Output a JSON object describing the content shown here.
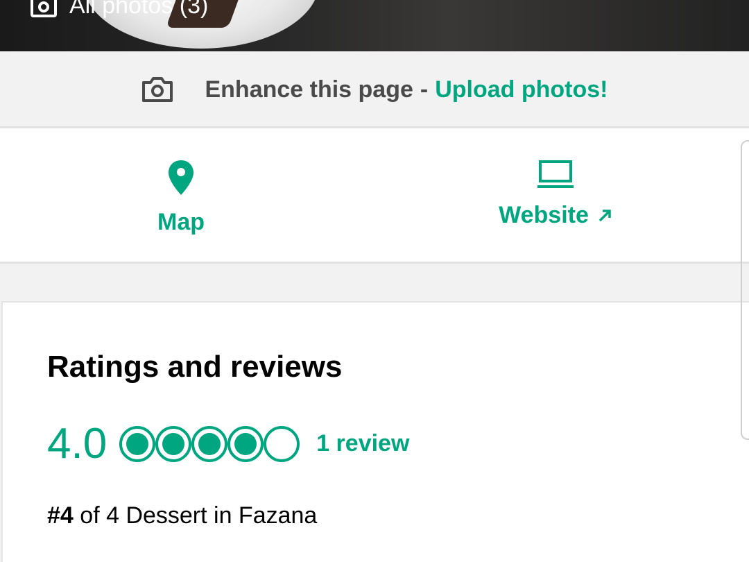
{
  "hero": {
    "label": "All photos (3)",
    "icon": "camera-icon"
  },
  "enhance": {
    "icon": "camera-icon",
    "text": "Enhance this page",
    "separator": "-",
    "link": "Upload photos!"
  },
  "actions": [
    {
      "label": "Map",
      "icon": "map-pin-icon"
    },
    {
      "label": "Website",
      "icon": "laptop-icon",
      "trailing_icon": "external-arrow-icon"
    }
  ],
  "ratings": {
    "title": "Ratings and reviews",
    "score": "4.0",
    "bubbles_filled": 4,
    "bubbles_total": 5,
    "review_count": "1 review",
    "rank_number": "#4",
    "rank_text": "of 4 Dessert in Fazana"
  },
  "colors": {
    "accent": "#00a680",
    "text_dark": "#000000",
    "text_gray": "#4a4a4a",
    "background": "#f2f2f2"
  }
}
